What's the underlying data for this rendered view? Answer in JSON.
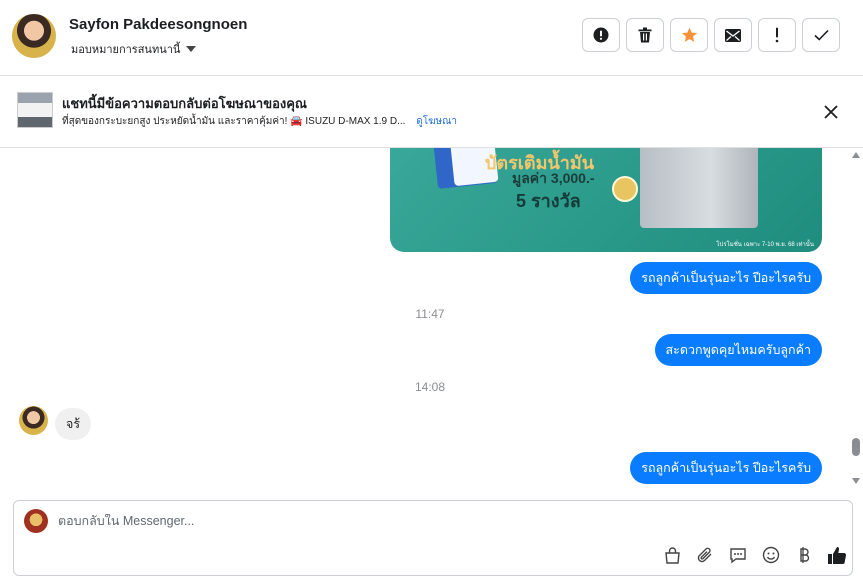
{
  "header": {
    "name": "Sayfon Pakdeesongnoen",
    "assign_label": "มอบหมายการสนทนานี้",
    "actions": [
      {
        "name": "mark-spam",
        "icon": "exclamation-circle-icon"
      },
      {
        "name": "delete",
        "icon": "trash-icon"
      },
      {
        "name": "star",
        "icon": "star-icon"
      },
      {
        "name": "mark-unread",
        "icon": "envelope-icon"
      },
      {
        "name": "follow-up",
        "icon": "exclamation-icon"
      },
      {
        "name": "done",
        "icon": "checkmark-icon"
      }
    ]
  },
  "ad": {
    "title": "แชทนี้มีข้อความตอบกลับต่อโฆษณาของคุณ",
    "subtitle": "ที่สุดของกระบะยกสูง ประหยัดน้ำมัน และราคาคุ้มค่า! 🚘 ISUZU D-MAX 1.9 D...",
    "link_label": "ดูโฆษณา"
  },
  "promo": {
    "title": "บัตรเติมน้ำมัน",
    "value": "มูลค่า 3,000.-",
    "count": "5 รางวัล",
    "footnote": "โปรโมชั่น เฉพาะ 7-10 พ.ย. 68 เท่านั้น"
  },
  "messages": [
    {
      "type": "out",
      "text": "รถลูกค้าเป็นรุ่นอะไร ปีอะไรครับ"
    },
    {
      "type": "time",
      "text": "11:47"
    },
    {
      "type": "out",
      "text": "สะดวกพูดคุยไหมครับลูกค้า"
    },
    {
      "type": "time",
      "text": "14:08"
    },
    {
      "type": "in",
      "text": "จร้"
    },
    {
      "type": "out",
      "text": "รถลูกค้าเป็นรุ่นอะไร ปีอะไรครับ"
    }
  ],
  "composer": {
    "placeholder": "ตอบกลับใน Messenger...",
    "tools": [
      "shopping-bag-icon",
      "paperclip-icon",
      "saved-reply-icon",
      "emoji-icon",
      "baht-icon",
      "thumbs-up-icon"
    ]
  },
  "colors": {
    "accent": "#0A7CFF",
    "star": "#F7923A",
    "link": "#216FDB"
  }
}
